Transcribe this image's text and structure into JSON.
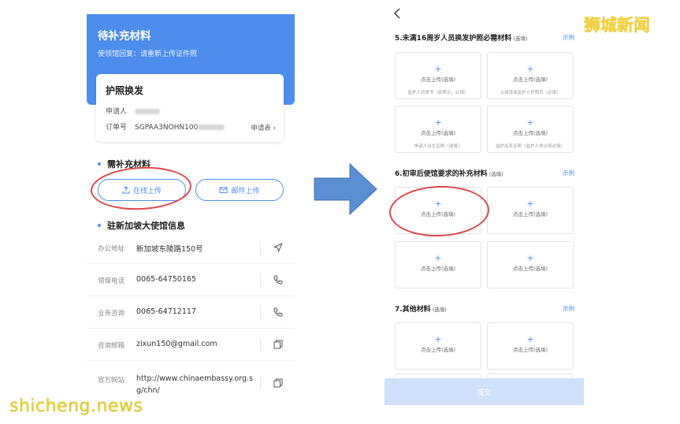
{
  "left": {
    "banner": {
      "title": "待补充材料",
      "subtitle": "使领馆回复：请重新上传证件照"
    },
    "card": {
      "title": "护照换发",
      "applicant_label": "申请人",
      "order_label": "订单号",
      "order_value": "SGPAA3NOHN100",
      "apply_link": "申请表 ›"
    },
    "supplement": {
      "title": "需补充材料",
      "online_upload": "在线上传",
      "mail_upload": "邮件上传"
    },
    "embassy": {
      "title": "驻新加坡大使馆信息",
      "rows": [
        {
          "label": "办公地址",
          "value": "新加坡东陵路150号",
          "icon": "navigation-icon"
        },
        {
          "label": "领保电话",
          "value": "0065-64750165",
          "icon": "phone-icon"
        },
        {
          "label": "业务咨询",
          "value": "0065-64712117",
          "icon": "phone-icon"
        },
        {
          "label": "咨询邮箱",
          "value": "zixun150@gmail.com",
          "icon": "copy-icon"
        },
        {
          "label": "官方网站",
          "value_line1": "http://www.chinaembassy.org.s",
          "value_line2": "g/chn/",
          "icon": "copy-icon"
        }
      ]
    }
  },
  "right": {
    "sections": [
      {
        "title": "5.未满16周岁人员换发护照必需材料",
        "optional": "(选填)",
        "example": "示例",
        "tiles": [
          {
            "plus": "+",
            "label": "点击上传",
            "optional": "(选填)",
            "desc": "监护人同意书（纸质示，必填）"
          },
          {
            "plus": "+",
            "label": "点击上传",
            "optional": "(选填)",
            "desc": "父或母或监护人护照页（必填）"
          },
          {
            "plus": "+",
            "label": "点击上传",
            "optional": "(选填)",
            "desc": "申请人出生证明（选填）"
          },
          {
            "plus": "+",
            "label": "点击上传",
            "optional": "(选填)",
            "desc": "监护关系证明（监护人非父母必填）"
          }
        ]
      },
      {
        "title": "6.初审后使馆要求的补充材料",
        "optional": "(选填)",
        "example": "示例",
        "tiles": [
          {
            "plus": "+",
            "label": "点击上传",
            "optional": "(选填)"
          },
          {
            "plus": "+",
            "label": "点击上传",
            "optional": "(选填)"
          },
          {
            "plus": "+",
            "label": "点击上传",
            "optional": "(选填)"
          },
          {
            "plus": "+",
            "label": "点击上传",
            "optional": "(选填)"
          }
        ]
      },
      {
        "title": "7.其他材料",
        "optional": "(选填)",
        "example": "示例",
        "tiles": [
          {
            "plus": "+",
            "label": "点击上传",
            "optional": "(选填)"
          },
          {
            "plus": "+",
            "label": "点击上传",
            "optional": "(选填)"
          }
        ]
      }
    ],
    "submit_label": "提交"
  },
  "watermark": {
    "top": "狮城新闻",
    "bottom": "shicheng.news"
  },
  "colors": {
    "accent": "#4d8eed",
    "highlight_ring": "#d9474a",
    "arrow": "#5b8fd4",
    "watermark": "#f4d23b"
  }
}
